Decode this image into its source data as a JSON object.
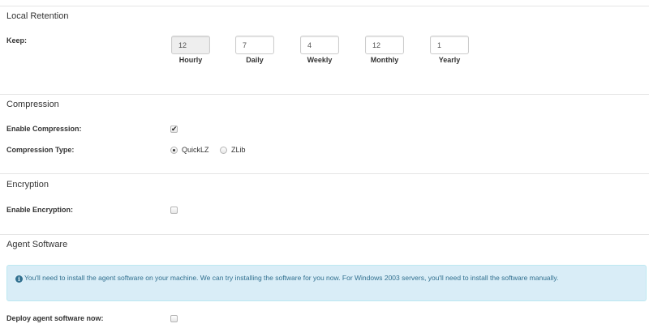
{
  "local_retention": {
    "title": "Local Retention",
    "keep_label": "Keep:",
    "fields": [
      {
        "value": "12",
        "caption": "Hourly"
      },
      {
        "value": "7",
        "caption": "Daily"
      },
      {
        "value": "4",
        "caption": "Weekly"
      },
      {
        "value": "12",
        "caption": "Monthly"
      },
      {
        "value": "1",
        "caption": "Yearly"
      }
    ]
  },
  "compression": {
    "title": "Compression",
    "enable_label": "Enable Compression:",
    "enabled": true,
    "type_label": "Compression Type:",
    "options": [
      "QuickLZ",
      "ZLib"
    ],
    "selected": "QuickLZ"
  },
  "encryption": {
    "title": "Encryption",
    "enable_label": "Enable Encryption:",
    "enabled": false
  },
  "agent_software": {
    "title": "Agent Software",
    "info_text": "You'll need to install the agent software on your machine. We can try installing the software for you now. For Windows 2003 servers, you'll need to install the software manually.",
    "deploy_label": "Deploy agent software now:",
    "deploy": false
  },
  "icons": {
    "info": "info-circle-icon",
    "check": "check-icon"
  },
  "colors": {
    "alert_bg": "#d9edf7",
    "alert_text": "#31708f",
    "disabled_input_bg": "#eeeeee"
  }
}
